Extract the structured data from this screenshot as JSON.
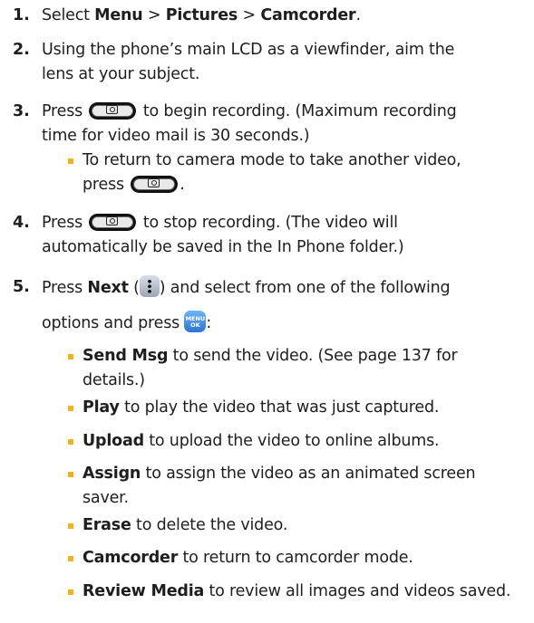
{
  "steps": [
    {
      "num": "1.",
      "l1_pre": "Select ",
      "menu": "Menu",
      "sep1": " > ",
      "pictures": "Pictures",
      "sep2": " > ",
      "camcorder": "Camcorder",
      "end": "."
    },
    {
      "num": "2.",
      "l1": "Using the phone’s main LCD as a viewfinder, aim the",
      "l2": "lens at your subject."
    },
    {
      "num": "3.",
      "l1_pre": "Press",
      "l1_post": "to begin recording. (Maximum recording",
      "l2": "time for video mail is 30 seconds.)",
      "bullet_l1": "To return to camera mode to take another video,",
      "bullet_l2_pre": "press",
      "bullet_l2_post": "."
    },
    {
      "num": "4.",
      "l1_pre": "Press",
      "l1_post": "to stop recording. (The video will",
      "l2": "automatically be saved in the In Phone folder.)"
    },
    {
      "num": "5.",
      "l1_pre": "Press ",
      "next": "Next",
      "l1_mid": " (",
      "l1_post": ") and select from one of the following",
      "l2_pre": "options and press",
      "l2_post": ":"
    }
  ],
  "options": [
    {
      "term": "Send Msg",
      "desc": " to send the video. (See page 137 for",
      "desc2": "details.)"
    },
    {
      "term": "Play",
      "desc": " to play the video that was just captured."
    },
    {
      "term": "Upload",
      "desc": " to upload the video to online albums."
    },
    {
      "term": "Assign",
      "desc": " to assign the video as an animated screen",
      "desc2": "saver."
    },
    {
      "term": "Erase",
      "desc": " to delete the video."
    },
    {
      "term": "Camcorder",
      "desc": " to return to camcorder mode."
    },
    {
      "term": "Review Media",
      "desc": " to review all images and videos saved."
    }
  ],
  "keys": {
    "menu_ok_top": "MENU",
    "menu_ok_bottom": "OK"
  },
  "colors": {
    "bullet": "#f2b21b",
    "text": "#1e1e1e",
    "menu_key": "#3a86e0"
  }
}
